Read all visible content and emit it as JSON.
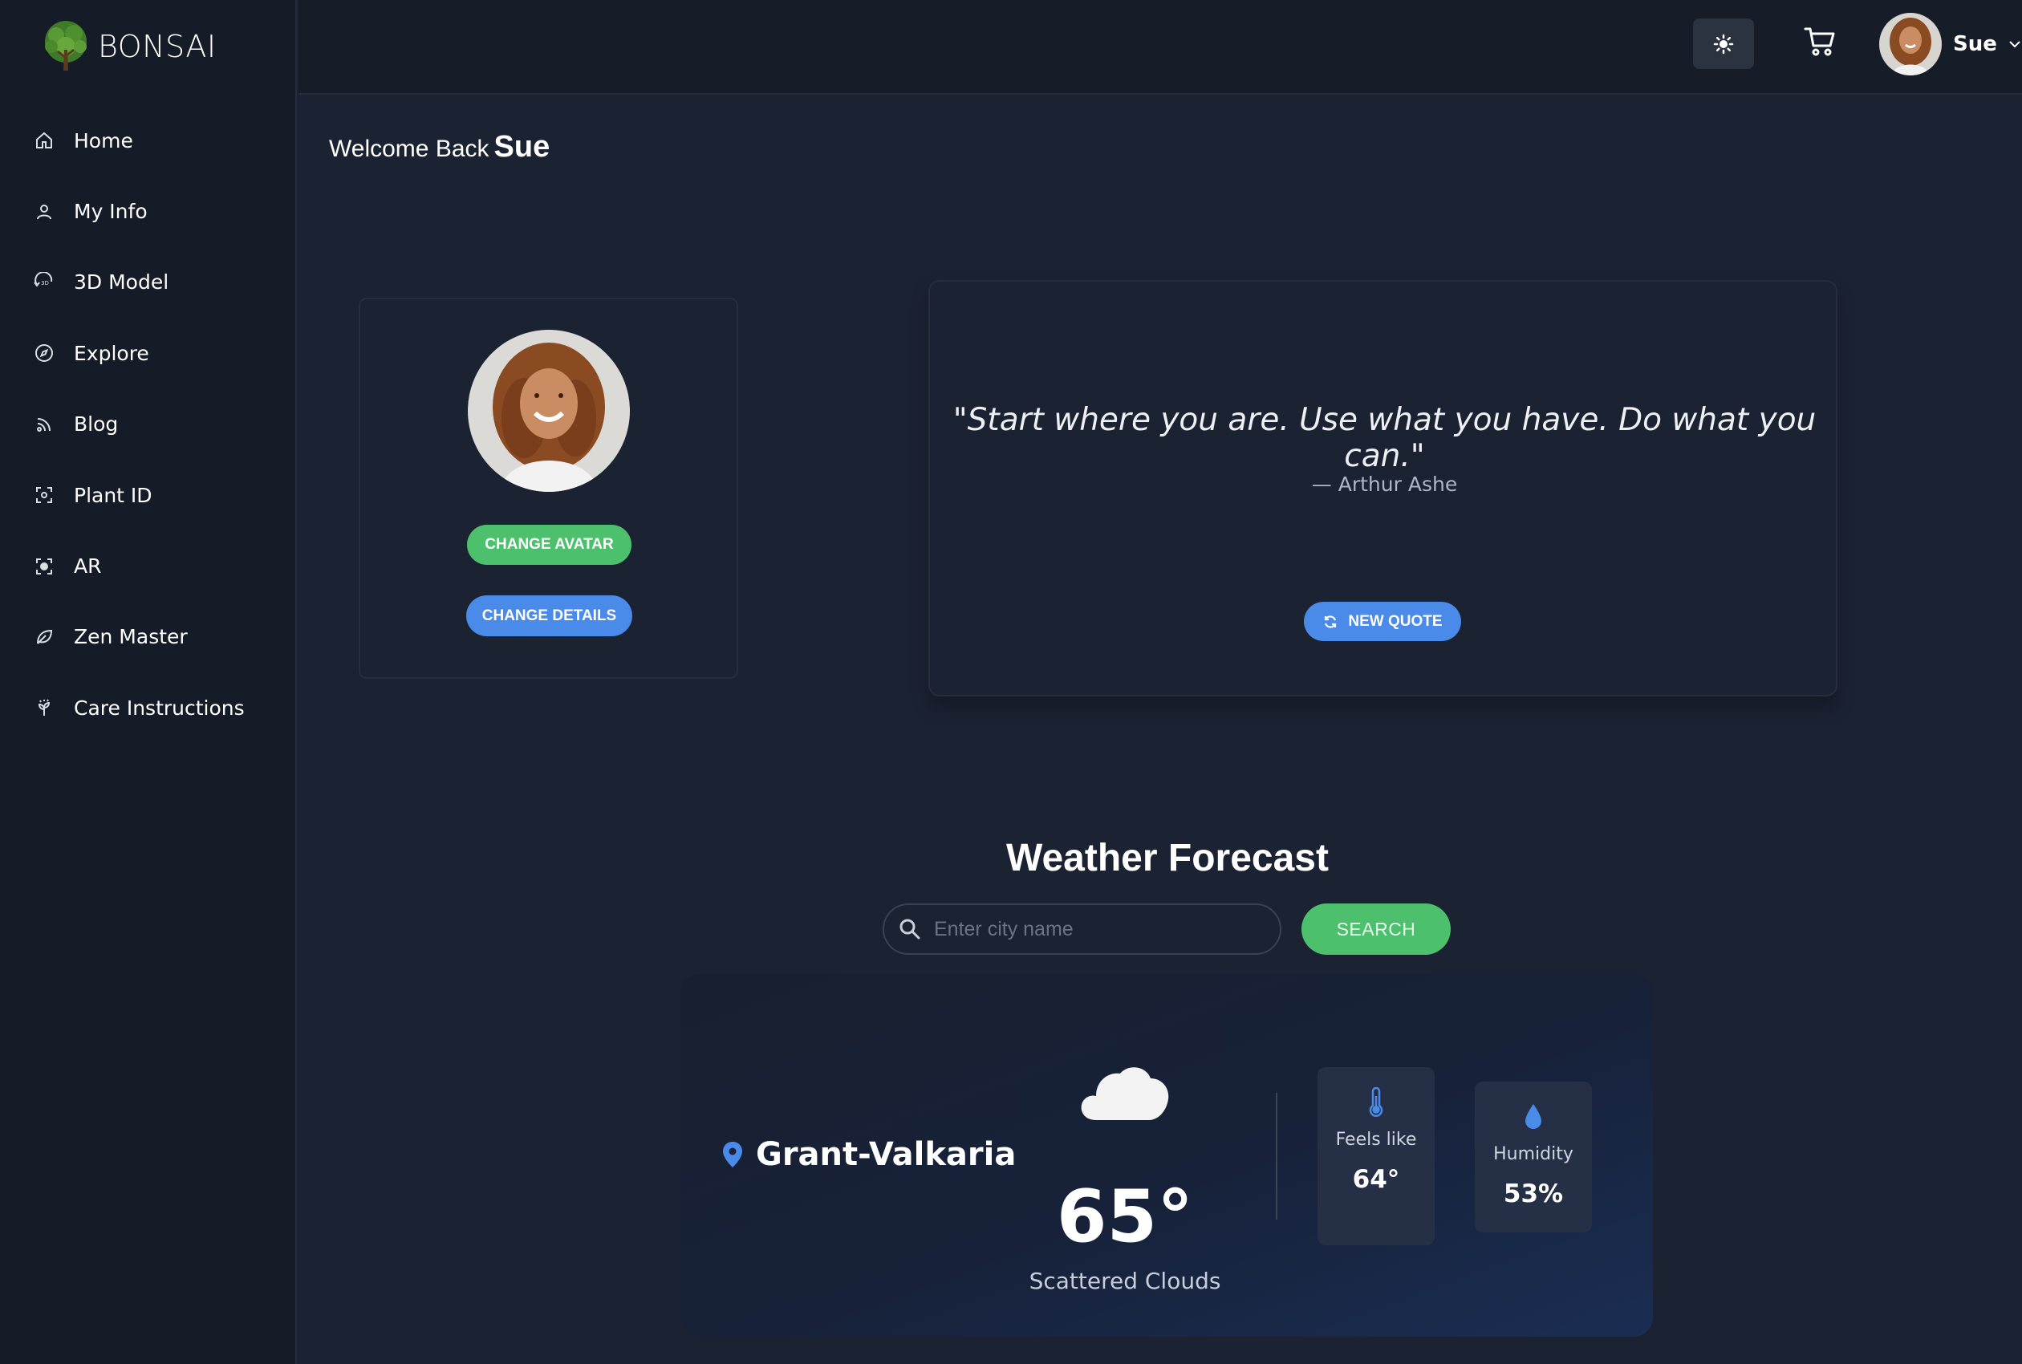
{
  "app": {
    "logo_text": "BONSAI"
  },
  "sidebar": {
    "items": [
      {
        "label": "Home",
        "icon": "home-icon"
      },
      {
        "label": "My Info",
        "icon": "user-icon"
      },
      {
        "label": "3D Model",
        "icon": "3d-rotate-icon"
      },
      {
        "label": "Explore",
        "icon": "compass-icon"
      },
      {
        "label": "Blog",
        "icon": "rss-icon"
      },
      {
        "label": "Plant ID",
        "icon": "scan-icon"
      },
      {
        "label": "AR",
        "icon": "ar-scan-icon"
      },
      {
        "label": "Zen Master",
        "icon": "leaf-icon"
      },
      {
        "label": "Care Instructions",
        "icon": "plant-care-icon"
      }
    ]
  },
  "header": {
    "user_name": "Sue",
    "theme_icon": "sun-icon",
    "cart_icon": "cart-icon"
  },
  "welcome": {
    "prefix": "Welcome Back",
    "name": "Sue"
  },
  "profile": {
    "change_avatar_label": "CHANGE AVATAR",
    "change_details_label": "CHANGE DETAILS"
  },
  "quote": {
    "text": "\"Start where you are. Use what you have. Do what you can.\"",
    "author": "— Arthur Ashe",
    "button_label": "NEW QUOTE"
  },
  "weather": {
    "title": "Weather Forecast",
    "search_placeholder": "Enter city name",
    "search_button": "SEARCH",
    "city": "Grant-Valkaria",
    "temperature": "65°",
    "description": "Scattered Clouds",
    "feels_like_label": "Feels like",
    "feels_like_value": "64°",
    "humidity_label": "Humidity",
    "humidity_value": "53%",
    "condition_icon": "cloud-icon"
  },
  "colors": {
    "accent_green": "#4cc06c",
    "accent_blue": "#4a8ae8",
    "background": "#1b2232",
    "sidebar": "#151b27"
  }
}
